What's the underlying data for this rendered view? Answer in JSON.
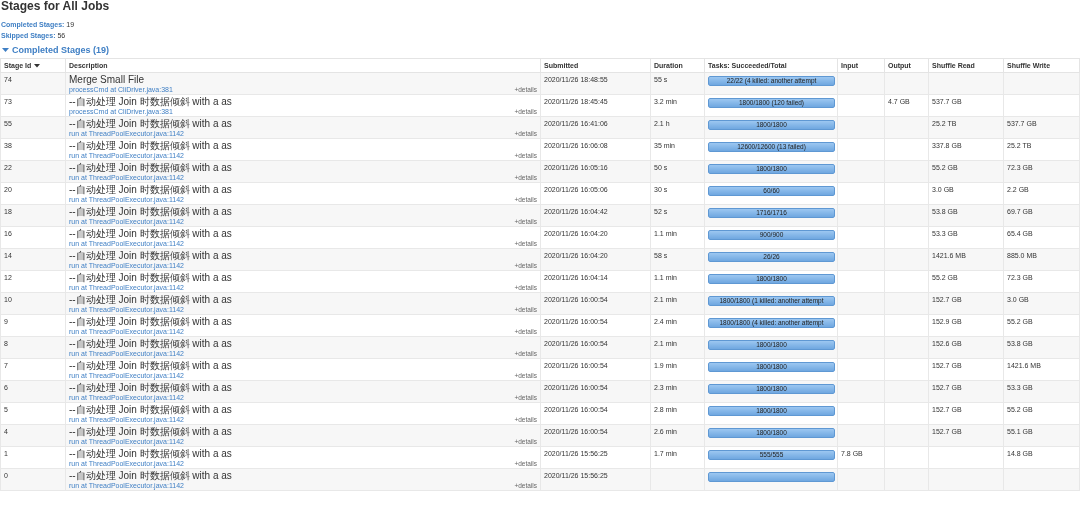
{
  "page_title": "Stages for All Jobs",
  "summary": [
    {
      "label": "Completed Stages:",
      "value": "19"
    },
    {
      "label": "Skipped Stages:",
      "value": "56"
    }
  ],
  "section": {
    "title": "Completed Stages (19)",
    "expanded": true
  },
  "table": {
    "columns": [
      {
        "label": "Stage Id",
        "sorted": true
      },
      {
        "label": "Description",
        "sorted": false
      },
      {
        "label": "Submitted",
        "sorted": false
      },
      {
        "label": "Duration",
        "sorted": false
      },
      {
        "label": "Tasks: Succeeded/Total",
        "sorted": false
      },
      {
        "label": "Input",
        "sorted": false
      },
      {
        "label": "Output",
        "sorted": false
      },
      {
        "label": "Shuffle Read",
        "sorted": false
      },
      {
        "label": "Shuffle Write",
        "sorted": false
      }
    ],
    "rows": [
      {
        "id": "74",
        "description": "Merge Small File",
        "link": "processCmd at CliDriver.java:381",
        "details": "+details",
        "submitted": "2020/11/26 18:48:55",
        "duration": "55 s",
        "tasks": "22/22 (4 killed: another attempt",
        "level": 1
      },
      {
        "id": "73",
        "description": "--自动处理 Join 时数据倾斜 with a as",
        "link": "processCmd at CliDriver.java:381",
        "details": "+details",
        "submitted": "2020/11/26 18:45:45",
        "duration": "3.2 min",
        "tasks": "1800/1800 (120 failed)",
        "level": 1,
        "output": "4.7 GB",
        "shuffle_read": "537.7 GB"
      },
      {
        "id": "55",
        "description": "--自动处理 Join 时数据倾斜 with a as",
        "link": "run at ThreadPoolExecutor.java:1142",
        "details": "+details",
        "submitted": "2020/11/26 16:41:06",
        "duration": "2.1 h",
        "tasks": "1800/1800",
        "level": 1,
        "shuffle_read": "25.2 TB",
        "shuffle_write": "537.7 GB"
      },
      {
        "id": "38",
        "description": "--自动处理 Join 时数据倾斜 with a as",
        "link": "run at ThreadPoolExecutor.java:1142",
        "details": "+details",
        "submitted": "2020/11/26 16:06:08",
        "duration": "35 min",
        "tasks": "12600/12600 (13 failed)",
        "level": 1,
        "shuffle_read": "337.8 GB",
        "shuffle_write": "25.2 TB"
      },
      {
        "id": "22",
        "description": "--自动处理 Join 时数据倾斜 with a as",
        "link": "run at ThreadPoolExecutor.java:1142",
        "details": "+details",
        "submitted": "2020/11/26 16:05:16",
        "duration": "50 s",
        "tasks": "1800/1800",
        "level": 1,
        "shuffle_read": "55.2 GB",
        "shuffle_write": "72.3 GB"
      },
      {
        "id": "20",
        "description": "--自动处理 Join 时数据倾斜 with a as",
        "link": "run at ThreadPoolExecutor.java:1142",
        "details": "+details",
        "submitted": "2020/11/26 16:05:06",
        "duration": "30 s",
        "tasks": "60/60",
        "level": 1,
        "shuffle_read": "3.0 GB",
        "shuffle_write": "2.2 GB"
      },
      {
        "id": "18",
        "description": "--自动处理 Join 时数据倾斜 with a as",
        "link": "run at ThreadPoolExecutor.java:1142",
        "details": "+details",
        "submitted": "2020/11/26 16:04:42",
        "duration": "52 s",
        "tasks": "1716/1716",
        "level": 1,
        "shuffle_read": "53.8 GB",
        "shuffle_write": "69.7 GB"
      },
      {
        "id": "16",
        "description": "--自动处理 Join 时数据倾斜 with a as",
        "link": "run at ThreadPoolExecutor.java:1142",
        "details": "+details",
        "submitted": "2020/11/26 16:04:20",
        "duration": "1.1 min",
        "tasks": "900/900",
        "level": 1,
        "shuffle_read": "53.3 GB",
        "shuffle_write": "65.4 GB"
      },
      {
        "id": "14",
        "description": "--自动处理 Join 时数据倾斜 with a as",
        "link": "run at ThreadPoolExecutor.java:1142",
        "details": "+details",
        "submitted": "2020/11/26 16:04:20",
        "duration": "58 s",
        "tasks": "26/26",
        "level": 1,
        "shuffle_read": "1421.6 MB",
        "shuffle_write": "885.0 MB"
      },
      {
        "id": "12",
        "description": "--自动处理 Join 时数据倾斜 with a as",
        "link": "run at ThreadPoolExecutor.java:1142",
        "details": "+details",
        "submitted": "2020/11/26 16:04:14",
        "duration": "1.1 min",
        "tasks": "1800/1800",
        "level": 1,
        "shuffle_read": "55.2 GB",
        "shuffle_write": "72.3 GB"
      },
      {
        "id": "10",
        "description": "--自动处理 Join 时数据倾斜 with a as",
        "link": "run at ThreadPoolExecutor.java:1142",
        "details": "+details",
        "submitted": "2020/11/26 16:00:54",
        "duration": "2.1 min",
        "tasks": "1800/1800 (1 killed: another attempt",
        "level": 1,
        "shuffle_read": "152.7 GB",
        "shuffle_write": "3.0 GB"
      },
      {
        "id": "9",
        "description": "--自动处理 Join 时数据倾斜 with a as",
        "link": "run at ThreadPoolExecutor.java:1142",
        "details": "+details",
        "submitted": "2020/11/26 16:00:54",
        "duration": "2.4 min",
        "tasks": "1800/1800 (4 killed: another attempt",
        "level": 1,
        "shuffle_read": "152.9 GB",
        "shuffle_write": "55.2 GB"
      },
      {
        "id": "8",
        "description": "--自动处理 Join 时数据倾斜 with a as",
        "link": "run at ThreadPoolExecutor.java:1142",
        "details": "+details",
        "submitted": "2020/11/26 16:00:54",
        "duration": "2.1 min",
        "tasks": "1800/1800",
        "level": 1,
        "shuffle_read": "152.6 GB",
        "shuffle_write": "53.8 GB"
      },
      {
        "id": "7",
        "description": "--自动处理 Join 时数据倾斜 with a as",
        "link": "run at ThreadPoolExecutor.java:1142",
        "details": "+details",
        "submitted": "2020/11/26 16:00:54",
        "duration": "1.9 min",
        "tasks": "1800/1800",
        "level": 1,
        "shuffle_read": "152.7 GB",
        "shuffle_write": "1421.6 MB"
      },
      {
        "id": "6",
        "description": "--自动处理 Join 时数据倾斜 with a as",
        "link": "run at ThreadPoolExecutor.java:1142",
        "details": "+details",
        "submitted": "2020/11/26 16:00:54",
        "duration": "2.3 min",
        "tasks": "1800/1800",
        "level": 1,
        "shuffle_read": "152.7 GB",
        "shuffle_write": "53.3 GB"
      },
      {
        "id": "5",
        "description": "--自动处理 Join 时数据倾斜 with a as",
        "link": "run at ThreadPoolExecutor.java:1142",
        "details": "+details",
        "submitted": "2020/11/26 16:00:54",
        "duration": "2.8 min",
        "tasks": "1800/1800",
        "level": 1,
        "shuffle_read": "152.7 GB",
        "shuffle_write": "55.2 GB"
      },
      {
        "id": "4",
        "description": "--自动处理 Join 时数据倾斜 with a as",
        "link": "run at ThreadPoolExecutor.java:1142",
        "details": "+details",
        "submitted": "2020/11/26 16:00:54",
        "duration": "2.6 min",
        "tasks": "1800/1800",
        "level": 1,
        "shuffle_read": "152.7 GB",
        "shuffle_write": "55.1 GB"
      },
      {
        "id": "1",
        "description": "--自动处理 Join 时数据倾斜 with a as",
        "link": "run at ThreadPoolExecutor.java:1142",
        "details": "+details",
        "submitted": "2020/11/26 15:56:25",
        "duration": "1.7 min",
        "tasks": "555/555",
        "level": 1,
        "input": "7.8 GB",
        "shuffle_write": "14.8 GB"
      },
      {
        "id": "0",
        "description": "--自动处理 Join 时数据倾斜 with a as",
        "link": "run at ThreadPoolExecutor.java:1142",
        "details": "+details",
        "submitted": "2020/11/26 15:56:25",
        "level": 1
      }
    ]
  }
}
